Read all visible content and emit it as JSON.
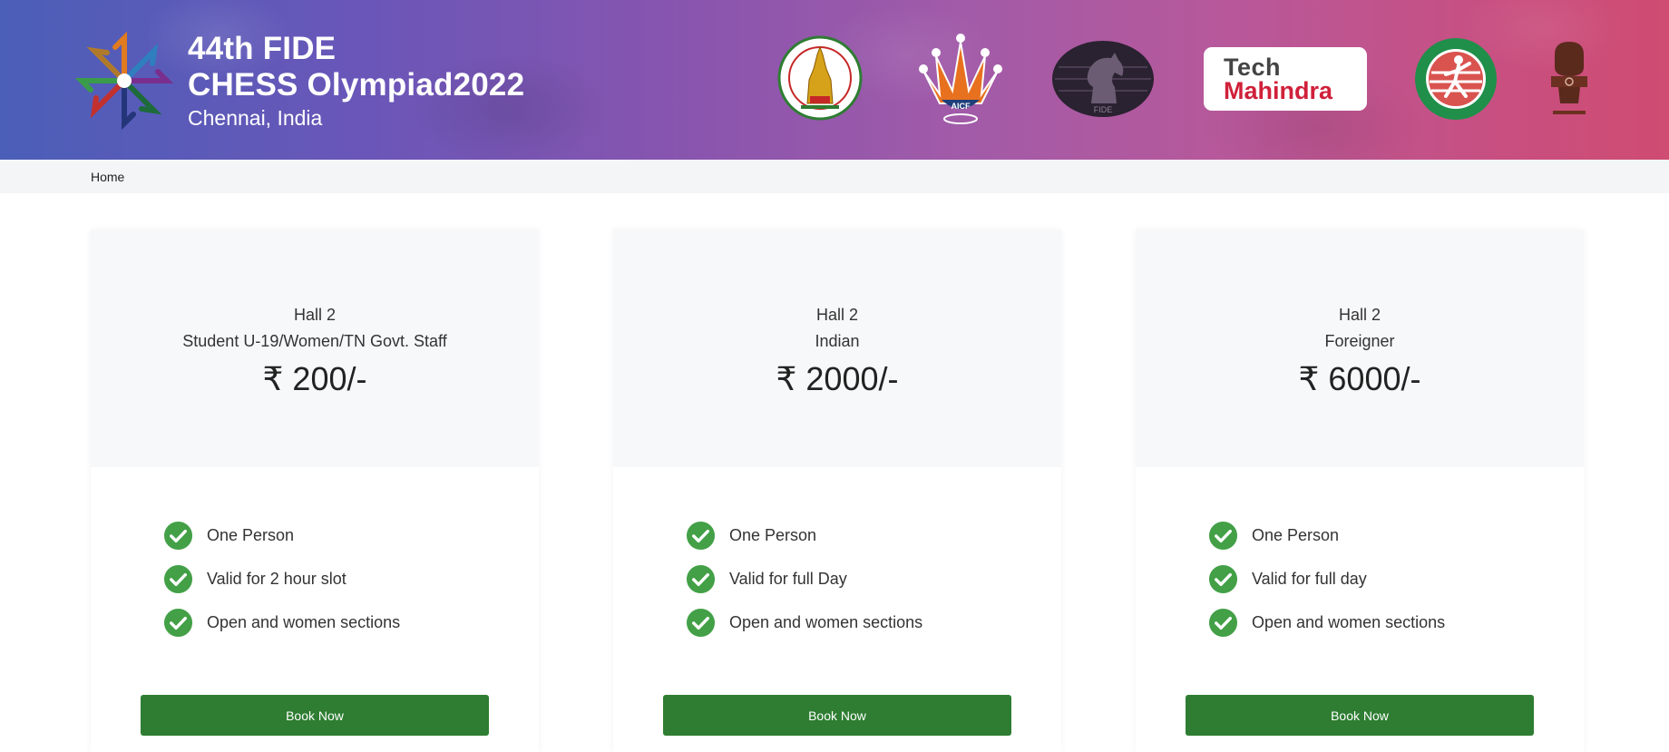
{
  "header": {
    "title_line1": "44th FIDE",
    "title_line2": "CHESS Olympiad2022",
    "location": "Chennai, India",
    "colors": {
      "banner_start": "#4b5fb8",
      "banner_end": "#cf4c72"
    },
    "partners": {
      "tech_mahindra_line1": "Tech",
      "tech_mahindra_line2": "Mahindra",
      "aicf": "AICF",
      "fide": "FIDE"
    }
  },
  "breadcrumb": {
    "home": "Home"
  },
  "colors": {
    "check": "#43a047",
    "button": "#2e7d32"
  },
  "cards": [
    {
      "hall": "Hall 2",
      "category": "Student U-19/Women/TN Govt. Staff",
      "price": "₹ 200/-",
      "features": [
        "One Person",
        "Valid for 2 hour slot",
        "Open and women sections"
      ],
      "button": "Book Now"
    },
    {
      "hall": "Hall 2",
      "category": "Indian",
      "price": "₹ 2000/-",
      "features": [
        "One Person",
        "Valid for full Day",
        "Open and women sections"
      ],
      "button": "Book Now"
    },
    {
      "hall": "Hall 2",
      "category": "Foreigner",
      "price": "₹ 6000/-",
      "features": [
        "One Person",
        "Valid for full day",
        "Open and women sections"
      ],
      "button": "Book Now"
    }
  ]
}
